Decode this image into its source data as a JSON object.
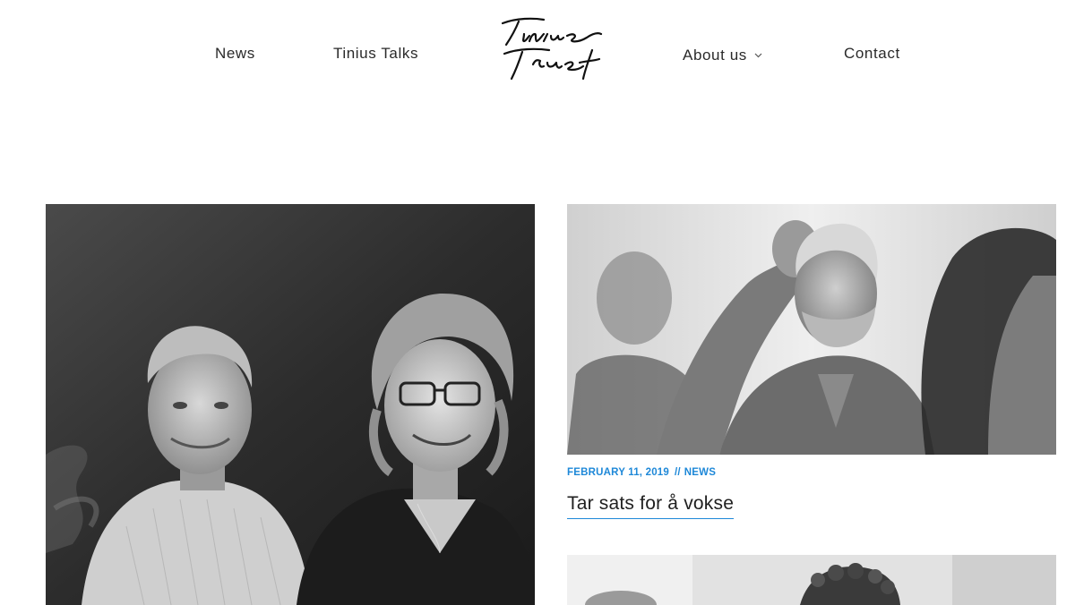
{
  "nav": {
    "items": [
      {
        "label": "News"
      },
      {
        "label": "Tinius Talks"
      },
      {
        "label": "About us"
      },
      {
        "label": "Contact"
      }
    ],
    "logo_text": "Tinius Trust",
    "dropdown_icon": "chevron-down-icon"
  },
  "posts": [
    {
      "image": "black-and-white-photo-man-and-woman-smiling"
    },
    {
      "image": "black-and-white-photo-bearded-man-in-conversation",
      "date": "FEBRUARY 11, 2019",
      "separator": "//",
      "category": "NEWS",
      "title": "Tar sats for å vokse"
    },
    {
      "image": "black-and-white-photo-curly-haired-person"
    }
  ],
  "colors": {
    "accent": "#1e88d8",
    "text": "#2a2a2a",
    "background": "#ffffff"
  }
}
